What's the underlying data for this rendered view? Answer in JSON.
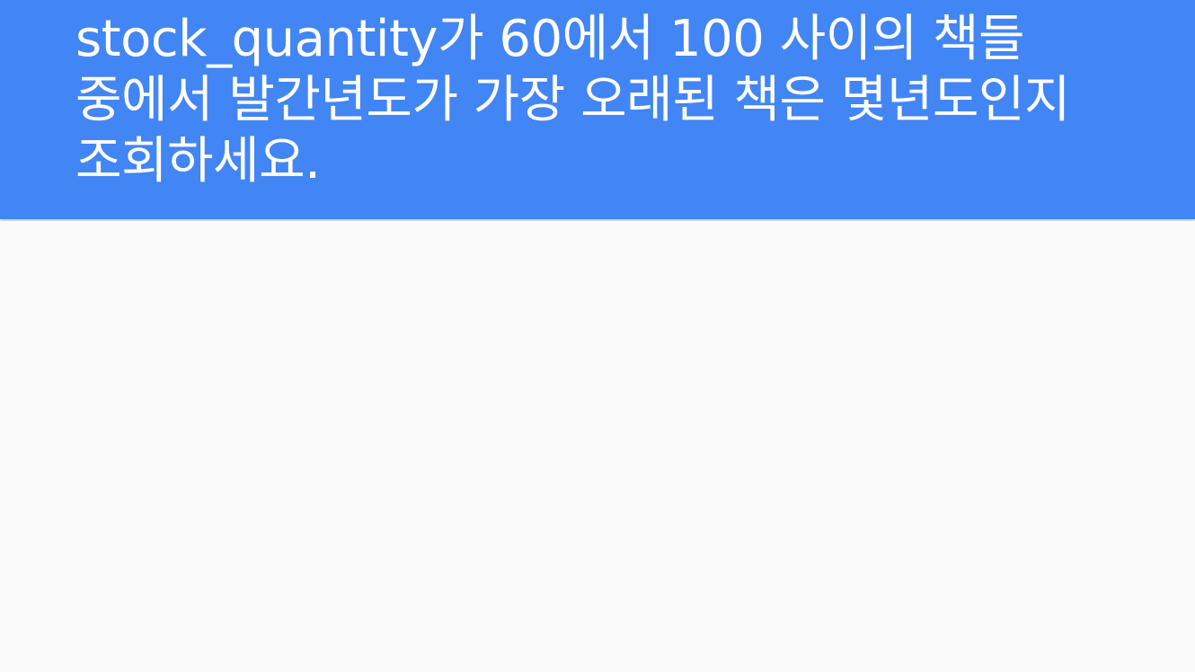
{
  "header": {
    "title": "stock_quantity가 60에서 100 사이의 책들 중에서 발간년도가 가장 오래된 책은 몇년도인지 조회하세요.",
    "background_color": "#4285f4",
    "text_color": "#ffffff"
  },
  "page": {
    "background_color": "#fafafa"
  }
}
